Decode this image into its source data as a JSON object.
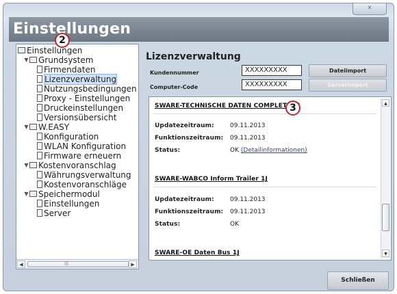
{
  "window": {
    "close_label": "✕"
  },
  "title": "Einstellungen",
  "tree": [
    {
      "label": "Einstellungen",
      "level": 0,
      "type": "folder",
      "toggle": ""
    },
    {
      "label": "Grundsystem",
      "level": 1,
      "type": "folder",
      "toggle": "▼"
    },
    {
      "label": "Firmendaten",
      "level": 2,
      "type": "doc",
      "toggle": ""
    },
    {
      "label": "Lizenzverwaltung",
      "level": 2,
      "type": "doc",
      "toggle": "",
      "selected": true
    },
    {
      "label": "Nutzungsbedingungen",
      "level": 2,
      "type": "doc",
      "toggle": ""
    },
    {
      "label": "Proxy - Einstellungen",
      "level": 2,
      "type": "doc",
      "toggle": ""
    },
    {
      "label": "Druckeinstellungen",
      "level": 2,
      "type": "doc",
      "toggle": ""
    },
    {
      "label": "Versionsübersicht",
      "level": 2,
      "type": "doc",
      "toggle": ""
    },
    {
      "label": "W.EASY",
      "level": 1,
      "type": "folder",
      "toggle": "▼"
    },
    {
      "label": "Konfiguration",
      "level": 2,
      "type": "doc",
      "toggle": ""
    },
    {
      "label": "WLAN Konfiguration",
      "level": 2,
      "type": "doc",
      "toggle": ""
    },
    {
      "label": "Firmware erneuern",
      "level": 2,
      "type": "doc",
      "toggle": ""
    },
    {
      "label": "Kostenvoranschlag",
      "level": 1,
      "type": "folder",
      "toggle": "▼"
    },
    {
      "label": "Währungsverwaltung",
      "level": 2,
      "type": "doc",
      "toggle": ""
    },
    {
      "label": "Kostenvoranschläge",
      "level": 2,
      "type": "doc",
      "toggle": ""
    },
    {
      "label": "Speichermodul",
      "level": 1,
      "type": "folder",
      "toggle": "▼"
    },
    {
      "label": "Einstellungen",
      "level": 2,
      "type": "doc",
      "toggle": ""
    },
    {
      "label": "Server",
      "level": 2,
      "type": "doc",
      "toggle": ""
    }
  ],
  "license": {
    "heading": "Lizenzverwaltung",
    "customer_label": "Kundennummer",
    "customer_value": "XXXXXXXXX",
    "computer_label": "Computer-Code",
    "computer_value": "XXXXXXXXX",
    "import_file_label": "Dateiimport",
    "import_server_label": "Serverimport"
  },
  "licenses": [
    {
      "name": "SWARE-TECHNISCHE DATEN COMPLETE 1J",
      "update_label": "Updatezeitraum:",
      "update_value": "09.11.2013",
      "function_label": "Funktionszeitraum:",
      "function_value": "09.11.2013",
      "status_label": "Status:",
      "status_value": "OK",
      "details_link": "(Detailinformationen)"
    },
    {
      "name": "SWARE-WABCO Inform Trailer 1J",
      "update_label": "Updatezeitraum:",
      "update_value": "09.11.2013",
      "function_label": "Funktionszeitraum:",
      "function_value": "09.11.2013",
      "status_label": "Status:",
      "status_value": "OK"
    },
    {
      "name": "SWARE-OE Daten Bus 1J"
    }
  ],
  "callouts": [
    "2",
    "3"
  ],
  "close_button": "Schließen",
  "scroll": {
    "up": "▲",
    "down": "▼",
    "left": "◀",
    "right": "▶"
  }
}
